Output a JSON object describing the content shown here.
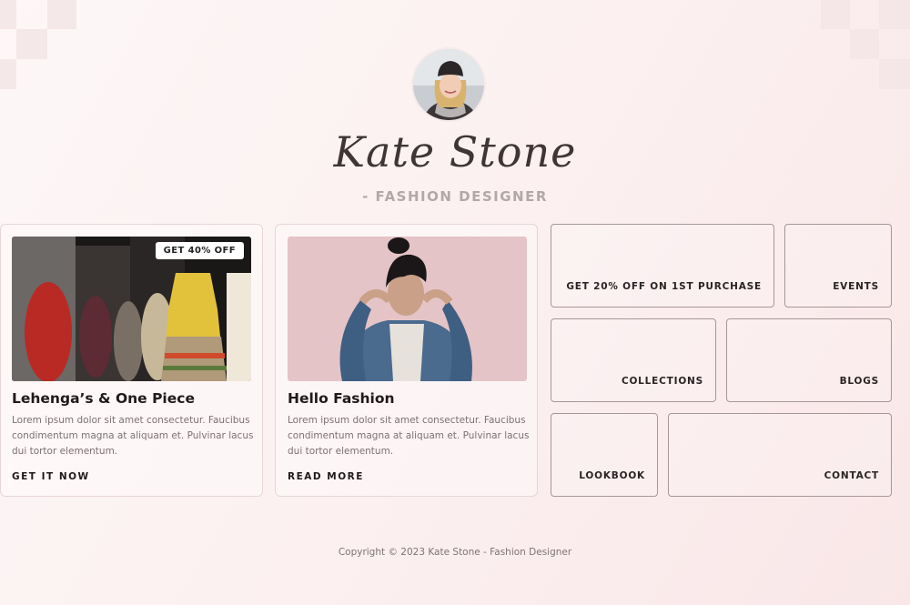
{
  "profile": {
    "name": "Kate Stone",
    "role": "- FASHION DESIGNER"
  },
  "cards": [
    {
      "badge": "GET 40% OFF",
      "title": "Lehenga’s & One Piece",
      "description": "Lorem ipsum dolor sit amet consectetur. Faucibus condimentum magna at aliquam et. Pulvinar lacus dui tortor elementum.",
      "cta": "GET IT NOW"
    },
    {
      "title": "Hello Fashion",
      "description": "Lorem ipsum dolor sit amet consectetur. Faucibus condimentum magna at aliquam et. Pulvinar lacus dui tortor elementum.",
      "cta": "READ MORE"
    }
  ],
  "tiles": {
    "offer": "GET 20% OFF ON 1ST PURCHASE",
    "events": "EVENTS",
    "collections": "COLLECTIONS",
    "blogs": "BLOGS",
    "lookbook": "LOOKBOOK",
    "contact": "CONTACT"
  },
  "footer": {
    "copyright": "Copyright © 2023 Kate Stone - Fashion Designer"
  },
  "colors": {
    "background": "#fcf1f1",
    "tile_border": "#a89698",
    "heading": "#1f1a1b"
  }
}
